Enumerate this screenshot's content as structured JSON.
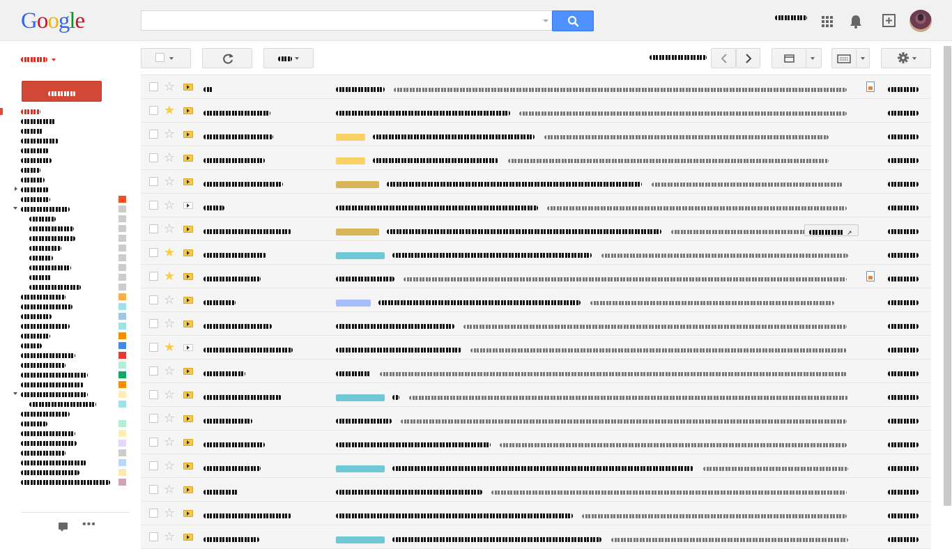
{
  "app": {
    "logo_text": "Google",
    "logo_colors": [
      "#3369e8",
      "#d50f25",
      "#eeb211",
      "#3369e8",
      "#009925",
      "#d50f25"
    ]
  },
  "search": {
    "placeholder": ""
  },
  "header": {
    "icons": [
      "apps-grid-icon",
      "notifications-bell-icon",
      "share-plus-icon"
    ]
  },
  "sidebar": {
    "nav_items": [
      {
        "swatch": "",
        "active": true,
        "expander": ""
      },
      {
        "swatch": "",
        "expander": ""
      },
      {
        "swatch": "",
        "expander": ""
      },
      {
        "swatch": "",
        "expander": ""
      },
      {
        "swatch": "",
        "expander": ""
      },
      {
        "swatch": "",
        "expander": ""
      },
      {
        "swatch": "",
        "expander": ""
      },
      {
        "swatch": "",
        "expander": ""
      },
      {
        "swatch": "",
        "expander": "right"
      },
      {
        "swatch": "#f4511e",
        "expander": ""
      },
      {
        "swatch": "#cccccc",
        "expander": "down"
      },
      {
        "swatch": "#cccccc",
        "indent": true
      },
      {
        "swatch": "#cccccc",
        "indent": true
      },
      {
        "swatch": "#cccccc",
        "indent": true
      },
      {
        "swatch": "#cccccc",
        "indent": true
      },
      {
        "swatch": "#cccccc",
        "indent": true
      },
      {
        "swatch": "#cccccc",
        "indent": true
      },
      {
        "swatch": "#cccccc",
        "indent": true
      },
      {
        "swatch": "#cccccc",
        "indent": true
      },
      {
        "swatch": "#ffad46"
      },
      {
        "swatch": "#9fe1e7"
      },
      {
        "swatch": "#9fc6e7"
      },
      {
        "swatch": "#9fe1e7"
      },
      {
        "swatch": "#fb8c00"
      },
      {
        "swatch": "#4a86e8"
      },
      {
        "swatch": "#e53935"
      },
      {
        "swatch": "#b3efd3"
      },
      {
        "swatch": "#16a765"
      },
      {
        "swatch": "#fb8c00"
      },
      {
        "swatch": "#fdeeb6",
        "expander": "down"
      },
      {
        "swatch": "#9fe1e7",
        "indent": true
      },
      {
        "swatch": ""
      },
      {
        "swatch": "#b3efd3"
      },
      {
        "swatch": "#fdeeb6"
      },
      {
        "swatch": "#e3d7ff"
      },
      {
        "swatch": "#cccccc"
      },
      {
        "swatch": "#b9d7f7"
      },
      {
        "swatch": "#fce8b3"
      },
      {
        "swatch": "#cca6ac"
      }
    ]
  },
  "emails": [
    {
      "star": false,
      "imp": true,
      "label": "",
      "attach": true,
      "chip": false
    },
    {
      "star": true,
      "imp": true,
      "label": "",
      "attach": false,
      "chip": false
    },
    {
      "star": false,
      "imp": true,
      "label": "#fad165",
      "attach": false,
      "chip": false
    },
    {
      "star": false,
      "imp": true,
      "label": "#fad165",
      "attach": false,
      "chip": false
    },
    {
      "star": false,
      "imp": true,
      "label": "#d9b55a",
      "attach": false,
      "chip": false
    },
    {
      "star": false,
      "imp": false,
      "label": "",
      "attach": false,
      "chip": false
    },
    {
      "star": false,
      "imp": true,
      "label": "#d9b55a",
      "attach": false,
      "chip": true
    },
    {
      "star": true,
      "imp": true,
      "label": "#6fc8d6",
      "attach": false,
      "chip": false
    },
    {
      "star": true,
      "imp": true,
      "label": "",
      "attach": true,
      "chip": false
    },
    {
      "star": false,
      "imp": true,
      "label": "#a4bdfc",
      "attach": false,
      "chip": false
    },
    {
      "star": false,
      "imp": true,
      "label": "",
      "attach": false,
      "chip": false
    },
    {
      "star": true,
      "imp": false,
      "label": "",
      "attach": false,
      "chip": false
    },
    {
      "star": false,
      "imp": true,
      "label": "",
      "attach": false,
      "chip": false
    },
    {
      "star": false,
      "imp": true,
      "label": "#6fc8d6",
      "attach": false,
      "chip": false
    },
    {
      "star": false,
      "imp": true,
      "label": "",
      "attach": false,
      "chip": false
    },
    {
      "star": false,
      "imp": true,
      "label": "",
      "attach": false,
      "chip": false
    },
    {
      "star": false,
      "imp": true,
      "label": "#6fc8d6",
      "attach": false,
      "chip": false
    },
    {
      "star": false,
      "imp": true,
      "label": "",
      "attach": false,
      "chip": false
    },
    {
      "star": false,
      "imp": true,
      "label": "",
      "attach": false,
      "chip": false
    },
    {
      "star": false,
      "imp": true,
      "label": "#6fc8d6",
      "attach": false,
      "chip": false
    }
  ]
}
